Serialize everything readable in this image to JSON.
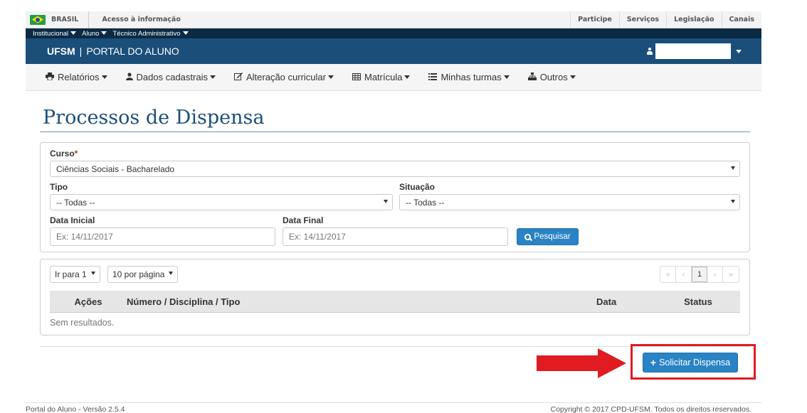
{
  "gov_bar": {
    "brasil": "BRASIL",
    "acesso": "Acesso à informação",
    "links": [
      "Participe",
      "Serviços",
      "Legislação",
      "Canais"
    ]
  },
  "sub_nav": {
    "items": [
      "Institucional",
      "Aluno",
      "Técnico Administrativo"
    ]
  },
  "portal": {
    "brand": "UFSM",
    "separator": "|",
    "name": "PORTAL DO ALUNO"
  },
  "menu": {
    "items": [
      {
        "label": "Relatórios",
        "icon": "printer-icon"
      },
      {
        "label": "Dados cadastrais",
        "icon": "user-icon"
      },
      {
        "label": "Alteração curricular",
        "icon": "edit-icon"
      },
      {
        "label": "Matrícula",
        "icon": "table-icon"
      },
      {
        "label": "Minhas turmas",
        "icon": "list-icon"
      },
      {
        "label": "Outros",
        "icon": "sitemap-icon"
      }
    ]
  },
  "page_title": "Processos de Dispensa",
  "filters": {
    "curso_label": "Curso",
    "curso_required": "*",
    "curso_value": "Ciências Sociais - Bacharelado",
    "tipo_label": "Tipo",
    "tipo_value": "-- Todas --",
    "situacao_label": "Situação",
    "situacao_value": "-- Todas --",
    "data_inicial_label": "Data Inicial",
    "data_inicial_placeholder": "Ex: 14/11/2017",
    "data_final_label": "Data Final",
    "data_final_placeholder": "Ex: 14/11/2017",
    "search_button": "Pesquisar"
  },
  "results": {
    "goto_select": "Ir para 1",
    "per_page_select": "10 por página",
    "pager": [
      "«",
      "‹",
      "1",
      "›",
      "»"
    ],
    "columns": [
      "Ações",
      "Número / Disciplina / Tipo",
      "Data",
      "Status"
    ],
    "empty_text": "Sem resultados."
  },
  "actions": {
    "request_button": "Solicitar Dispensa"
  },
  "footer": {
    "version": "Portal do Aluno - Versão 2.5.4",
    "copyright": "Copyright © 2017 CPD-UFSM. Todos os direitos reservados."
  },
  "colors": {
    "primary": "#2a83c5",
    "portal_bar": "#1b4f7a",
    "highlight": "#e01b22"
  }
}
